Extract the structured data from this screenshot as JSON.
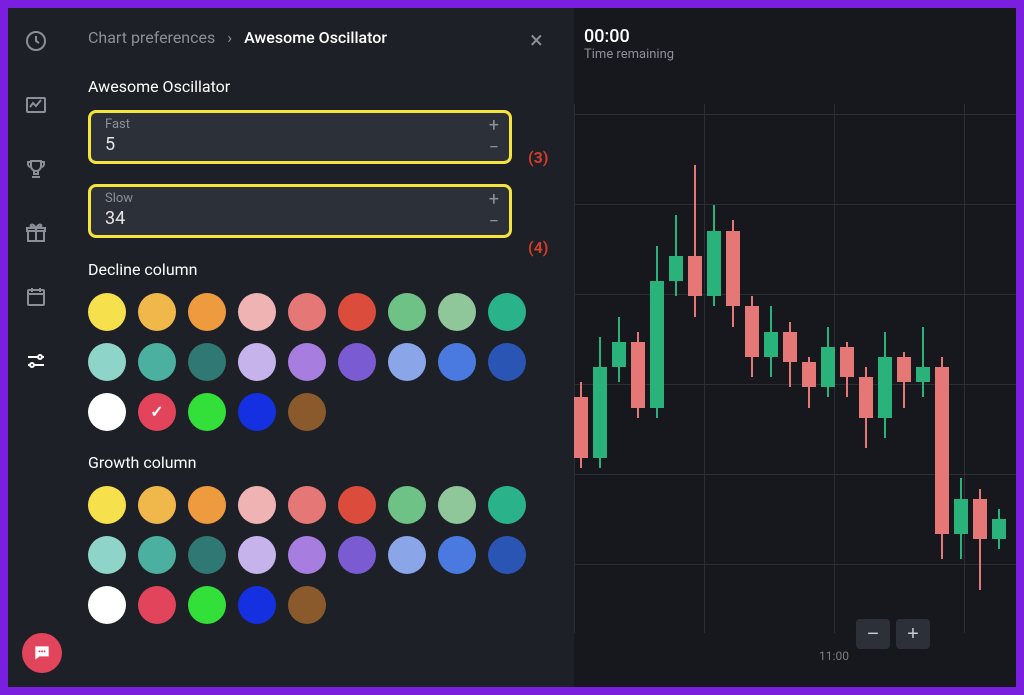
{
  "sidebar": {
    "icons": [
      "clock-icon",
      "chart-icon",
      "trophy-icon",
      "gift-icon",
      "calendar-icon",
      "sliders-icon"
    ],
    "active_index": 5
  },
  "panel": {
    "breadcrumb_root": "Chart preferences",
    "breadcrumb_current": "Awesome Oscillator",
    "title": "Awesome Oscillator",
    "fast_label": "Fast",
    "fast_value": "5",
    "slow_label": "Slow",
    "slow_value": "34",
    "decline_title": "Decline column",
    "growth_title": "Growth column",
    "callout_3": "(3)",
    "callout_4": "(4)"
  },
  "palette": [
    "#f6e04b",
    "#f0b84a",
    "#ee9b40",
    "#f0b3b3",
    "#e57777",
    "#db4c3c",
    "#6ec285",
    "#8fc79a",
    "#2ab28a",
    "#8fd4c9",
    "#4bb0a0",
    "#2f7873",
    "#c7b3ec",
    "#a77de0",
    "#7b5bd1",
    "#8aa6e8",
    "#4a7ae0",
    "#2b55b5",
    "#ffffff",
    "#e2445c",
    "#33e03a",
    "#1430e0",
    "#8a5a2c"
  ],
  "decline_selected_index": 19,
  "growth_selected_index": -1,
  "chart": {
    "time_value": "00:00",
    "time_label": "Time remaining",
    "x_ticks": [
      "11:00"
    ],
    "zoom_out": "−",
    "zoom_in": "+"
  },
  "chart_data": {
    "type": "candle",
    "ylim": [
      0,
      100
    ],
    "candles": [
      {
        "dir": "down",
        "o": 42,
        "c": 30,
        "h": 45,
        "l": 28
      },
      {
        "dir": "up",
        "o": 30,
        "c": 48,
        "h": 54,
        "l": 28
      },
      {
        "dir": "up",
        "o": 48,
        "c": 53,
        "h": 58,
        "l": 45
      },
      {
        "dir": "down",
        "o": 53,
        "c": 40,
        "h": 55,
        "l": 38
      },
      {
        "dir": "up",
        "o": 40,
        "c": 65,
        "h": 72,
        "l": 38
      },
      {
        "dir": "up",
        "o": 65,
        "c": 70,
        "h": 78,
        "l": 62
      },
      {
        "dir": "down",
        "o": 70,
        "c": 62,
        "h": 88,
        "l": 58
      },
      {
        "dir": "up",
        "o": 62,
        "c": 75,
        "h": 80,
        "l": 60
      },
      {
        "dir": "down",
        "o": 75,
        "c": 60,
        "h": 77,
        "l": 56
      },
      {
        "dir": "down",
        "o": 60,
        "c": 50,
        "h": 62,
        "l": 46
      },
      {
        "dir": "up",
        "o": 50,
        "c": 55,
        "h": 60,
        "l": 46
      },
      {
        "dir": "down",
        "o": 55,
        "c": 49,
        "h": 57,
        "l": 44
      },
      {
        "dir": "down",
        "o": 49,
        "c": 44,
        "h": 50,
        "l": 40
      },
      {
        "dir": "up",
        "o": 44,
        "c": 52,
        "h": 56,
        "l": 42
      },
      {
        "dir": "down",
        "o": 52,
        "c": 46,
        "h": 53,
        "l": 42
      },
      {
        "dir": "down",
        "o": 46,
        "c": 38,
        "h": 48,
        "l": 32
      },
      {
        "dir": "up",
        "o": 38,
        "c": 50,
        "h": 55,
        "l": 34
      },
      {
        "dir": "down",
        "o": 50,
        "c": 45,
        "h": 51,
        "l": 40
      },
      {
        "dir": "up",
        "o": 45,
        "c": 48,
        "h": 56,
        "l": 42
      },
      {
        "dir": "down",
        "o": 48,
        "c": 15,
        "h": 50,
        "l": 10
      },
      {
        "dir": "up",
        "o": 15,
        "c": 22,
        "h": 26,
        "l": 10
      },
      {
        "dir": "down",
        "o": 22,
        "c": 14,
        "h": 24,
        "l": 4
      },
      {
        "dir": "up",
        "o": 14,
        "c": 18,
        "h": 20,
        "l": 12
      }
    ]
  }
}
